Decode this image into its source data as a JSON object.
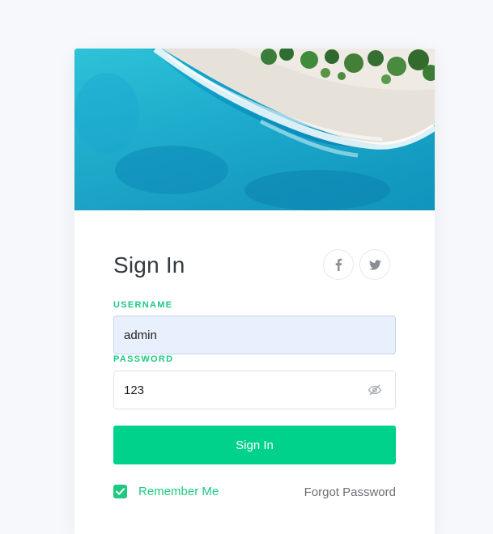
{
  "hero": {
    "image": "aerial-beach-photo"
  },
  "form": {
    "title": "Sign In",
    "social": [
      {
        "name": "facebook-icon",
        "glyph": "f"
      },
      {
        "name": "twitter-icon",
        "glyph": "twitter"
      }
    ],
    "username": {
      "label": "USERNAME",
      "value": "admin"
    },
    "password": {
      "label": "PASSWORD",
      "value": "123"
    },
    "submit_label": "Sign In",
    "remember_label": "Remember Me",
    "remember_checked": true,
    "forgot_label": "Forgot Password"
  },
  "colors": {
    "accent": "#00d18b",
    "label_green": "#1ec981",
    "page_bg": "#f6f8fc"
  }
}
